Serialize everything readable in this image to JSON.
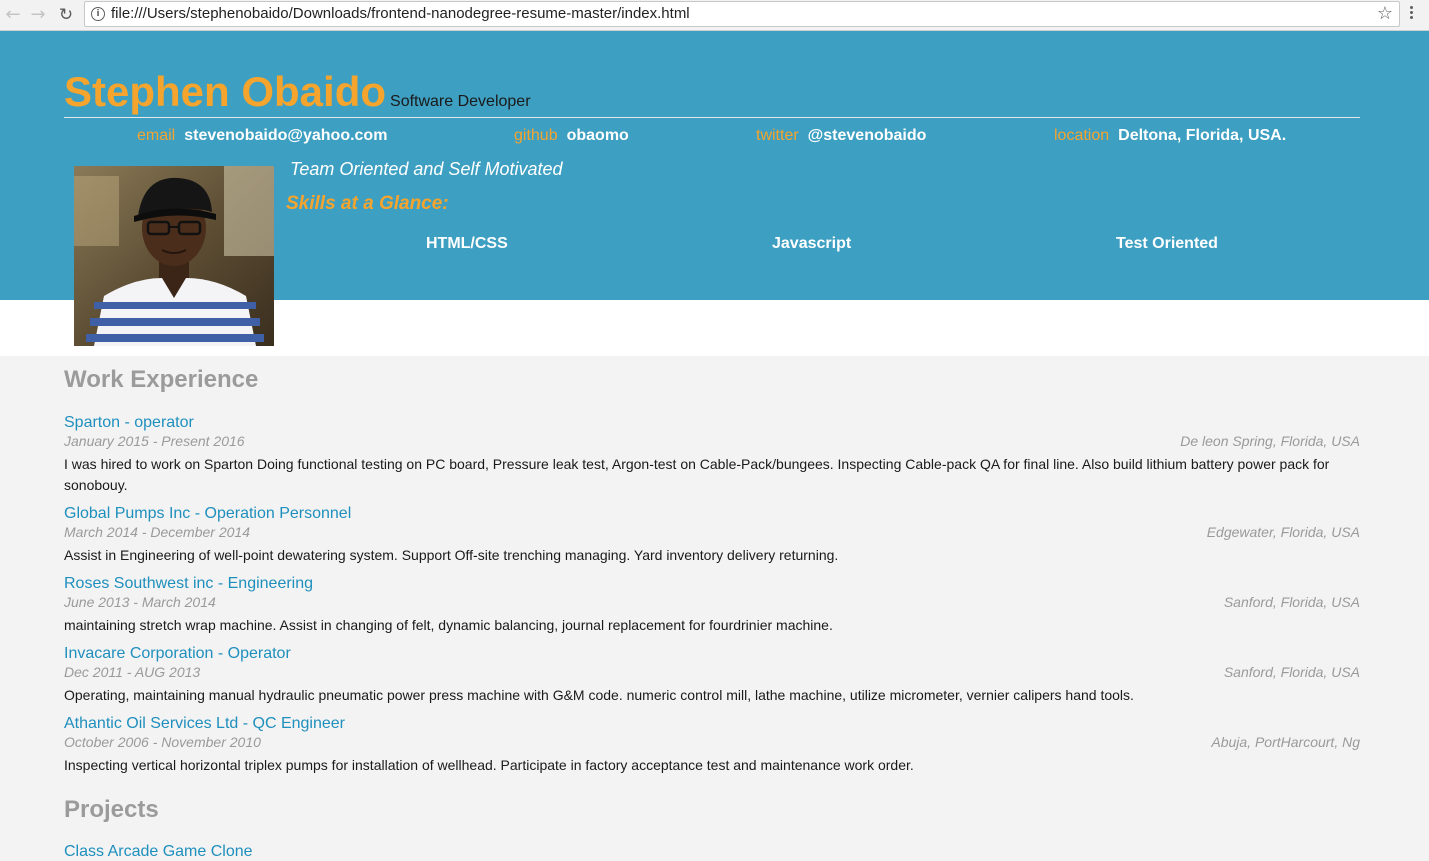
{
  "browser": {
    "url": "file:///Users/stephenobaido/Downloads/frontend-nanodegree-resume-master/index.html",
    "back_icon": "back-arrow-icon",
    "forward_icon": "forward-arrow-icon",
    "reload_icon": "reload-icon",
    "info_icon": "info-icon",
    "star_icon": "star-icon"
  },
  "header": {
    "name": "Stephen Obaido",
    "role": "Software Developer",
    "contacts": [
      {
        "label": "email",
        "value": "stevenobaido@yahoo.com"
      },
      {
        "label": "github",
        "value": "obaomo"
      },
      {
        "label": "twitter",
        "value": "@stevenobaido"
      },
      {
        "label": "location",
        "value": "Deltona, Florida, USA."
      }
    ],
    "welcome": "Team Oriented and Self Motivated",
    "skills_heading": "Skills at a Glance:",
    "skills": [
      "HTML/CSS",
      "Javascript",
      "Test Oriented"
    ]
  },
  "work": {
    "title": "Work Experience",
    "jobs": [
      {
        "title": "Sparton - operator",
        "dates": "January 2015 - Present 2016",
        "location": "De leon Spring, Florida, USA",
        "description": "I was hired to work on Sparton Doing functional testing on PC board, Pressure leak test, Argon-test on Cable-Pack/bungees. Inspecting Cable-pack QA for final line. Also build lithium battery power pack for sonobouy."
      },
      {
        "title": "Global Pumps Inc - Operation Personnel",
        "dates": "March 2014 - December 2014",
        "location": "Edgewater, Florida, USA",
        "description": "Assist in Engineering of well-point dewatering system. Support Off-site trenching managing. Yard inventory delivery returning."
      },
      {
        "title": "Roses Southwest inc - Engineering",
        "dates": "June 2013 - March 2014",
        "location": "Sanford, Florida, USA",
        "description": "maintaining stretch wrap machine. Assist in changing of felt, dynamic balancing, journal replacement for fourdrinier machine."
      },
      {
        "title": "Invacare Corporation - Operator",
        "dates": "Dec 2011 - AUG 2013",
        "location": "Sanford, Florida, USA",
        "description": "Operating, maintaining manual hydraulic pneumatic power press machine with G&M code. numeric control mill, lathe machine, utilize micrometer, vernier calipers hand tools."
      },
      {
        "title": "Athantic Oil Services Ltd - QC Engineer",
        "dates": "October 2006 - November 2010",
        "location": "Abuja, PortHarcourt, Ng",
        "description": "Inspecting vertical horizontal triplex pumps for installation of wellhead. Participate in factory acceptance test and maintenance work order."
      }
    ]
  },
  "projects": {
    "title": "Projects",
    "items": [
      {
        "title": "Class Arcade Game Clone"
      }
    ]
  },
  "colors": {
    "header_bg": "#3d9fc1",
    "accent_orange": "#f5a42e",
    "link_blue": "#1f8fbd",
    "muted_gray": "#9a9a9a",
    "page_bg": "#f3f3f3"
  }
}
